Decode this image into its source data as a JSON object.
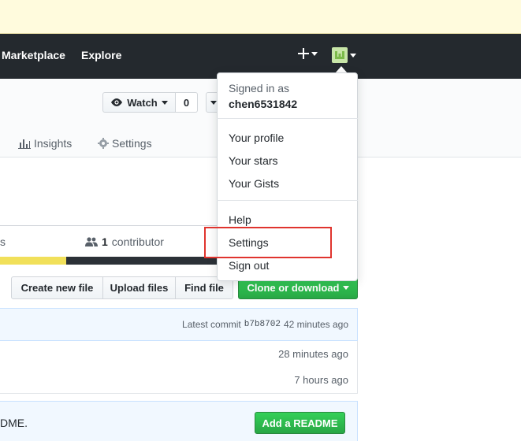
{
  "header": {
    "nav": [
      "Marketplace",
      "Explore"
    ],
    "plus_icon": "plus-icon",
    "avatar_icon": "avatar-icon"
  },
  "repohead": {
    "watch_label": "Watch",
    "watch_count": "0",
    "tabs": [
      {
        "label": "Insights",
        "icon": "graph-icon"
      },
      {
        "label": "Settings",
        "icon": "gear-icon"
      }
    ]
  },
  "stats": {
    "left_fragment": "s",
    "contributors_count": "1",
    "contributors_label": "contributor"
  },
  "file_nav": {
    "create": "Create new file",
    "upload": "Upload files",
    "find": "Find file",
    "clone": "Clone or download"
  },
  "commit": {
    "prefix": "Latest commit",
    "sha": "b7b8702",
    "time": "42 minutes ago"
  },
  "rows": [
    {
      "time": "28 minutes ago"
    },
    {
      "time": "7 hours ago"
    }
  ],
  "readme": {
    "text_fragment": "DME.",
    "button": "Add a README"
  },
  "dropdown": {
    "signed_in_as": "Signed in as",
    "username": "chen6531842",
    "items_1": [
      "Your profile",
      "Your stars",
      "Your Gists"
    ],
    "items_2": [
      "Help",
      "Settings",
      "Sign out"
    ]
  },
  "colors": {
    "header_bg": "#24292e",
    "flash_bg": "#fffbdd",
    "green": "#28a745",
    "highlight": "#e0342e"
  }
}
